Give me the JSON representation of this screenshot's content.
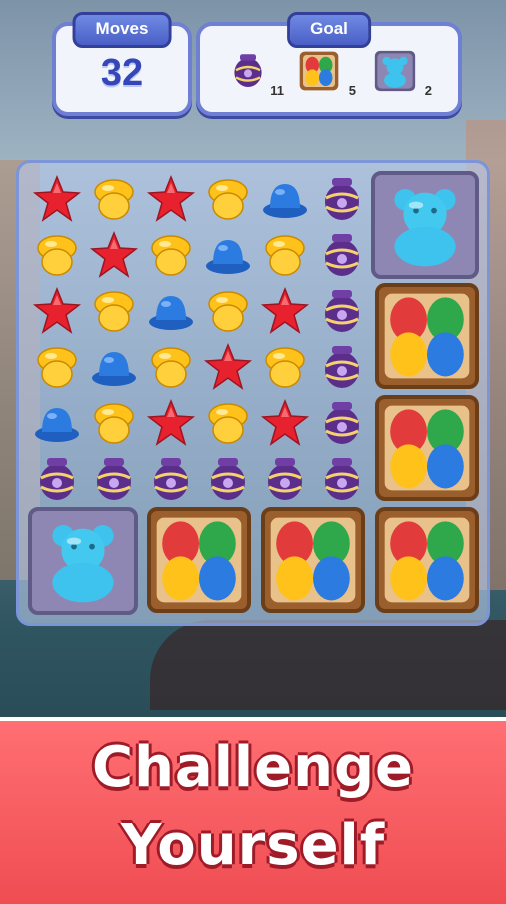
{
  "hud": {
    "moves_label": "Moves",
    "moves_value": "32",
    "goal_label": "Goal",
    "goals": [
      {
        "icon": "vase-icon",
        "count": "11"
      },
      {
        "icon": "egg-crate-icon",
        "count": "5"
      },
      {
        "icon": "jelly-bear-icon",
        "count": "2"
      }
    ]
  },
  "board": {
    "rows": [
      [
        "star",
        "acorn",
        "star",
        "acorn",
        "hat",
        "vase"
      ],
      [
        "acorn",
        "star",
        "acorn",
        "hat",
        "acorn",
        "vase"
      ],
      [
        "star",
        "acorn",
        "hat",
        "acorn",
        "star",
        "vase"
      ],
      [
        "acorn",
        "hat",
        "acorn",
        "star",
        "acorn",
        "vase"
      ],
      [
        "hat",
        "acorn",
        "star",
        "acorn",
        "star",
        "vase"
      ],
      [
        "vase",
        "vase",
        "vase",
        "vase",
        "vase",
        "vase"
      ]
    ],
    "colors": {
      "star": "#e8212e",
      "acorn": "#ffc21a",
      "hat": "#2c7be0",
      "vase": "#5b2e8c",
      "bear": "#3ec3ee",
      "crate": "#9b5e2d"
    }
  },
  "banner": {
    "line1": "Challenge",
    "line2": "Yourself"
  }
}
